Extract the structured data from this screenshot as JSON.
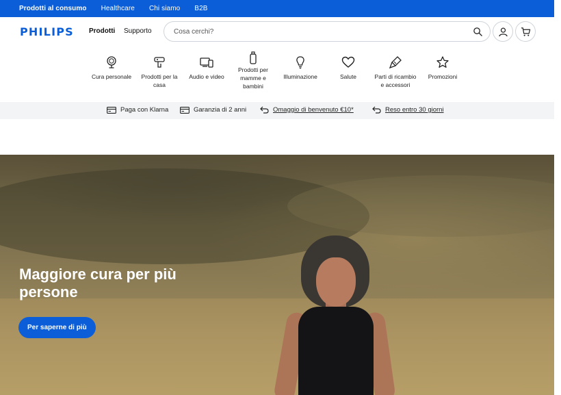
{
  "topbar": {
    "links": [
      "Prodotti al consumo",
      "Healthcare",
      "Chi siamo",
      "B2B"
    ]
  },
  "header": {
    "logo": "PHILIPS",
    "nav_products": "Prodotti",
    "nav_support": "Supporto",
    "search_placeholder": "Cosa cerchi?"
  },
  "categories": [
    {
      "label": "Cura personale",
      "icon": "mirror-icon"
    },
    {
      "label": "Prodotti per la casa",
      "icon": "iron-icon"
    },
    {
      "label": "Audio e video",
      "icon": "devices-icon"
    },
    {
      "label": "Prodotti per mamme e bambini",
      "icon": "baby-bottle-icon"
    },
    {
      "label": "Illuminazione",
      "icon": "lightbulb-icon"
    },
    {
      "label": "Salute",
      "icon": "heart-icon"
    },
    {
      "label": "Parti di ricambio e accessori",
      "icon": "brush-icon"
    },
    {
      "label": "Promozioni",
      "icon": "star-icon"
    }
  ],
  "benefits": [
    {
      "label": "Paga con Klarna",
      "icon": "card-icon"
    },
    {
      "label": "Garanzia di 2 anni",
      "icon": "card-icon"
    },
    {
      "label": "Omaggio di benvenuto €10*",
      "icon": "return-arrow-icon"
    },
    {
      "label": "Reso entro 30 giorni",
      "icon": "return-arrow-icon"
    }
  ],
  "hero": {
    "title": "Maggiore cura per più persone",
    "cta": "Per saperne di più"
  },
  "colors": {
    "brand": "#0b5ed7",
    "strip": "#f3f4f5"
  }
}
